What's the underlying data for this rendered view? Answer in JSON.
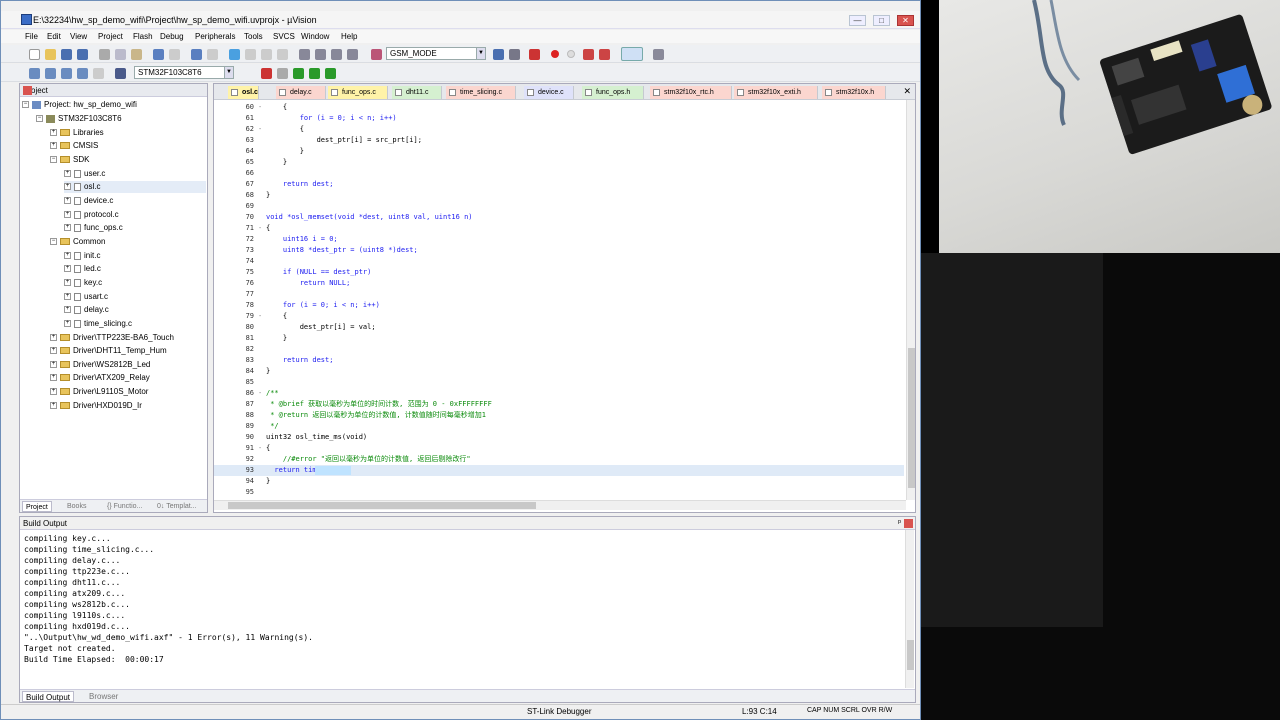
{
  "window": {
    "title": "E:\\32234\\hw_sp_demo_wifi\\Project\\hw_sp_demo_wifi.uvprojx - µVision",
    "buttons": [
      "—",
      "□",
      "✕"
    ]
  },
  "menu": [
    "File",
    "Edit",
    "View",
    "Project",
    "Flash",
    "Debug",
    "Peripherals",
    "Tools",
    "SVCS",
    "Window",
    "Help"
  ],
  "toolbar": {
    "combo1": "GSM_MODE",
    "target_combo": "STM32F103C8T6"
  },
  "project_pane": {
    "title": "Project",
    "tree": [
      "Project: hw_sp_demo_wifi",
      "STM32F103C8T6",
      "Libraries",
      "CMSIS",
      "SDK",
      "user.c",
      "osl.c",
      "device.c",
      "protocol.c",
      "func_ops.c",
      "Common",
      "init.c",
      "led.c",
      "key.c",
      "usart.c",
      "delay.c",
      "time_slicing.c",
      "Driver\\TTP223E-BA6_Touch",
      "Driver\\DHT11_Temp_Hum",
      "Driver\\WS2812B_Led",
      "Driver\\ATX209_Relay",
      "Driver\\L9110S_Motor",
      "Driver\\HXD019D_Ir"
    ],
    "tabs": [
      "Project",
      "Books",
      "{} Functio...",
      "0↓ Templat..."
    ]
  },
  "editor": {
    "tabs": [
      "osl.c",
      "delay.c",
      "func_ops.c",
      "dht11.c",
      "time_slicing.c",
      "device.c",
      "func_ops.h",
      "stm32f10x_rtc.h",
      "stm32f10x_exti.h",
      "stm32f10x.h"
    ],
    "lines": [
      {
        "n": "60",
        "t": "    {"
      },
      {
        "n": "61",
        "t": "        for (i = 0; i < n; i++)"
      },
      {
        "n": "62",
        "t": "        {"
      },
      {
        "n": "63",
        "t": "            dest_ptr[i] = src_prt[i];"
      },
      {
        "n": "64",
        "t": "        }"
      },
      {
        "n": "65",
        "t": "    }"
      },
      {
        "n": "66",
        "t": ""
      },
      {
        "n": "67",
        "t": "    return dest;"
      },
      {
        "n": "68",
        "t": "}"
      },
      {
        "n": "69",
        "t": ""
      },
      {
        "n": "70",
        "t": "void *osl_memset(void *dest, uint8 val, uint16 n)"
      },
      {
        "n": "71",
        "t": "{"
      },
      {
        "n": "72",
        "t": "    uint16 i = 0;"
      },
      {
        "n": "73",
        "t": "    uint8 *dest_ptr = (uint8 *)dest;"
      },
      {
        "n": "74",
        "t": ""
      },
      {
        "n": "75",
        "t": "    if (NULL == dest_ptr)"
      },
      {
        "n": "76",
        "t": "        return NULL;"
      },
      {
        "n": "77",
        "t": ""
      },
      {
        "n": "78",
        "t": "    for (i = 0; i < n; i++)"
      },
      {
        "n": "79",
        "t": "    {"
      },
      {
        "n": "80",
        "t": "        dest_ptr[i] = val;"
      },
      {
        "n": "81",
        "t": "    }"
      },
      {
        "n": "82",
        "t": ""
      },
      {
        "n": "83",
        "t": "    return dest;"
      },
      {
        "n": "84",
        "t": "}"
      },
      {
        "n": "85",
        "t": ""
      },
      {
        "n": "86",
        "t": "/**"
      },
      {
        "n": "87",
        "t": " * @brief 获取以毫秒为单位的时间计数, 范围为 0 - 0xFFFFFFFF"
      },
      {
        "n": "88",
        "t": " * @return 返回以毫秒为单位的计数值, 计数值随时间每毫秒增加1"
      },
      {
        "n": "89",
        "t": " */"
      },
      {
        "n": "90",
        "t": "uint32 osl_time_ms(void)"
      },
      {
        "n": "91",
        "t": "{"
      },
      {
        "n": "92",
        "t": "    //#error \"返回以毫秒为单位的计数值, 返回后剔除改行\""
      },
      {
        "n": "93",
        "t": "  return time();"
      },
      {
        "n": "94",
        "t": "}"
      },
      {
        "n": "95",
        "t": ""
      }
    ]
  },
  "build_output": {
    "title": "Build Output",
    "lines": [
      "compiling key.c...",
      "compiling time_slicing.c...",
      "compiling delay.c...",
      "compiling ttp223e.c...",
      "compiling dht11.c...",
      "compiling atx209.c...",
      "compiling ws2812b.c...",
      "compiling l9110s.c...",
      "compiling hxd019d.c...",
      "\"..\\Output\\hw_wd_demo_wifi.axf\" - 1 Error(s), 11 Warning(s).",
      "Target not created.",
      "Build Time Elapsed:  00:00:17"
    ],
    "tabs": [
      "Build Output",
      "Browser"
    ]
  },
  "status": {
    "debugger": "ST-Link Debugger",
    "position": "L:93 C:14",
    "flags": "CAP  NUM  SCRL  OVR  R/W"
  }
}
